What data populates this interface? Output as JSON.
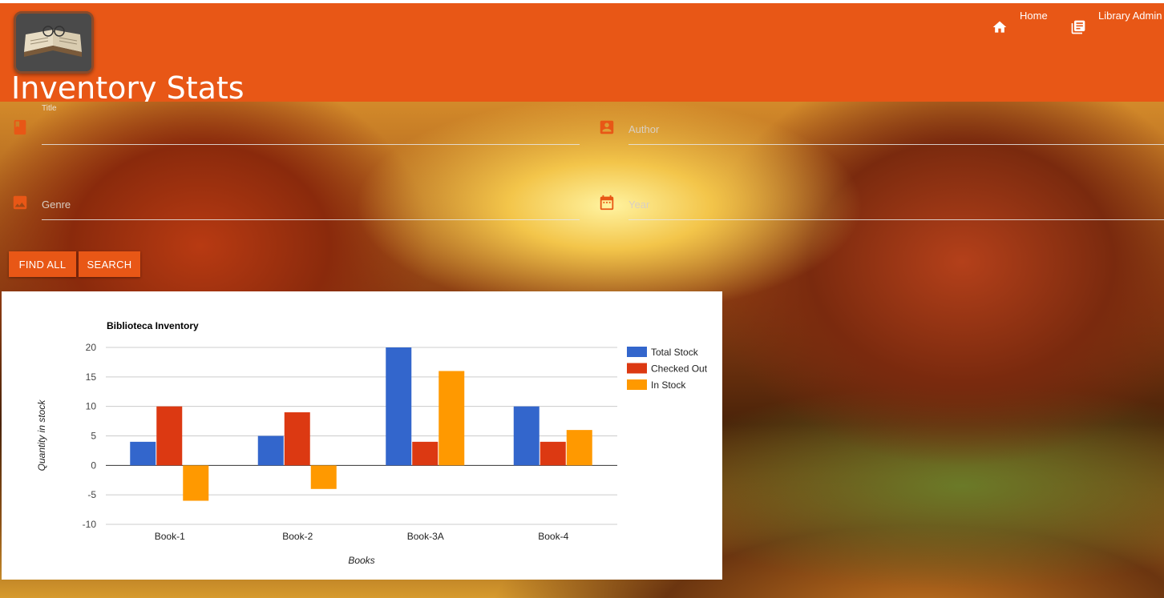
{
  "header": {
    "page_title": "Inventory Stats",
    "nav": [
      {
        "label": "Home",
        "icon": "home-icon"
      },
      {
        "label": "Library Admin",
        "icon": "library-books-icon"
      }
    ],
    "color": "#e85716"
  },
  "search_form": {
    "title": {
      "label": "Title",
      "value": "",
      "icon": "book-icon"
    },
    "author": {
      "placeholder": "Author",
      "value": "",
      "icon": "account-box-icon"
    },
    "genre": {
      "placeholder": "Genre",
      "value": "",
      "icon": "image-icon"
    },
    "year": {
      "placeholder": "Year",
      "value": "",
      "icon": "calendar-icon"
    },
    "find_all_label": "FIND ALL",
    "search_label": "SEARCH"
  },
  "chart_data": {
    "type": "bar",
    "title": "Biblioteca Inventory",
    "xlabel": "Books",
    "ylabel": "Quantity in stock",
    "categories": [
      "Book-1",
      "Book-2",
      "Book-3A",
      "Book-4"
    ],
    "ylim": [
      -10,
      20
    ],
    "yticks": [
      20,
      15,
      10,
      5,
      0,
      -5,
      -10
    ],
    "grid": true,
    "legend_position": "right",
    "series": [
      {
        "name": "Total Stock",
        "color": "#3366cc",
        "values": [
          4,
          5,
          20,
          10
        ]
      },
      {
        "name": "Checked Out",
        "color": "#dc3912",
        "values": [
          10,
          9,
          4,
          4
        ]
      },
      {
        "name": "In Stock",
        "color": "#ff9900",
        "values": [
          -6,
          -4,
          16,
          6
        ]
      }
    ]
  }
}
